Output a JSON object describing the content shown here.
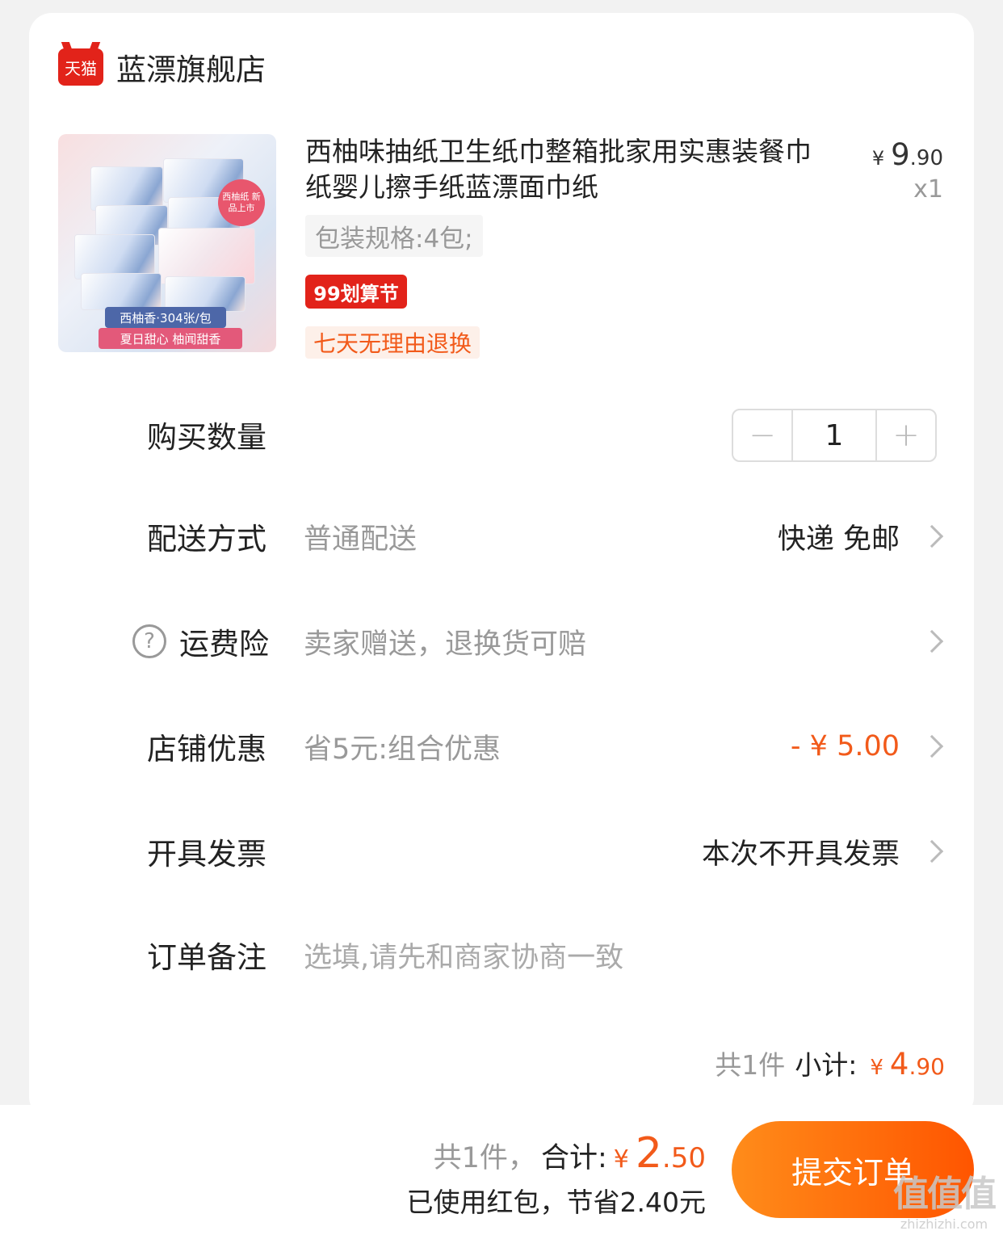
{
  "store": {
    "logo_text": "天猫",
    "name": "蓝漂旗舰店"
  },
  "product": {
    "title": "西柚味抽纸卫生纸巾整箱批家用实惠装餐巾纸婴儿擦手纸蓝漂面巾纸",
    "price_currency": "¥",
    "price_int": "9",
    "price_dec": ".90",
    "quantity_label": "x1",
    "spec": "包装规格:4包;",
    "promo_tag": "99划算节",
    "return_tag": "七天无理由退换",
    "image": {
      "badge": "西柚纸 新品上市",
      "label1": "西柚香·304张/包",
      "label2": "夏日甜心  柚闻甜香"
    }
  },
  "quantity": {
    "label": "购买数量",
    "value": "1",
    "minus": "−",
    "plus": "+"
  },
  "delivery": {
    "label": "配送方式",
    "sub": "普通配送",
    "value": "快递 免邮"
  },
  "insurance": {
    "label": "运费险",
    "sub": "卖家赠送，退换货可赔",
    "help": "?"
  },
  "store_discount": {
    "label": "店铺优惠",
    "sub": "省5元:组合优惠",
    "value": "- ¥ 5.00"
  },
  "invoice": {
    "label": "开具发票",
    "value": "本次不开具发票"
  },
  "note": {
    "label": "订单备注",
    "placeholder": "选填,请先和商家协商一致"
  },
  "subtotal": {
    "count": "共1件",
    "label": "小计:",
    "currency": "¥",
    "int": "4",
    "dec": ".90"
  },
  "footer": {
    "count": "共1件，",
    "label": "合计:",
    "currency": "¥",
    "int": "2",
    "dec": ".50",
    "saved": "已使用红包，节省2.40元",
    "submit": "提交订单"
  },
  "watermark": {
    "logo": "值值值",
    "url": "zhizhizhi.com"
  },
  "colors": {
    "accent": "#f25a1a",
    "tmall_red": "#e2231a",
    "submit_start": "#ff8c1a",
    "submit_end": "#ff5500"
  }
}
